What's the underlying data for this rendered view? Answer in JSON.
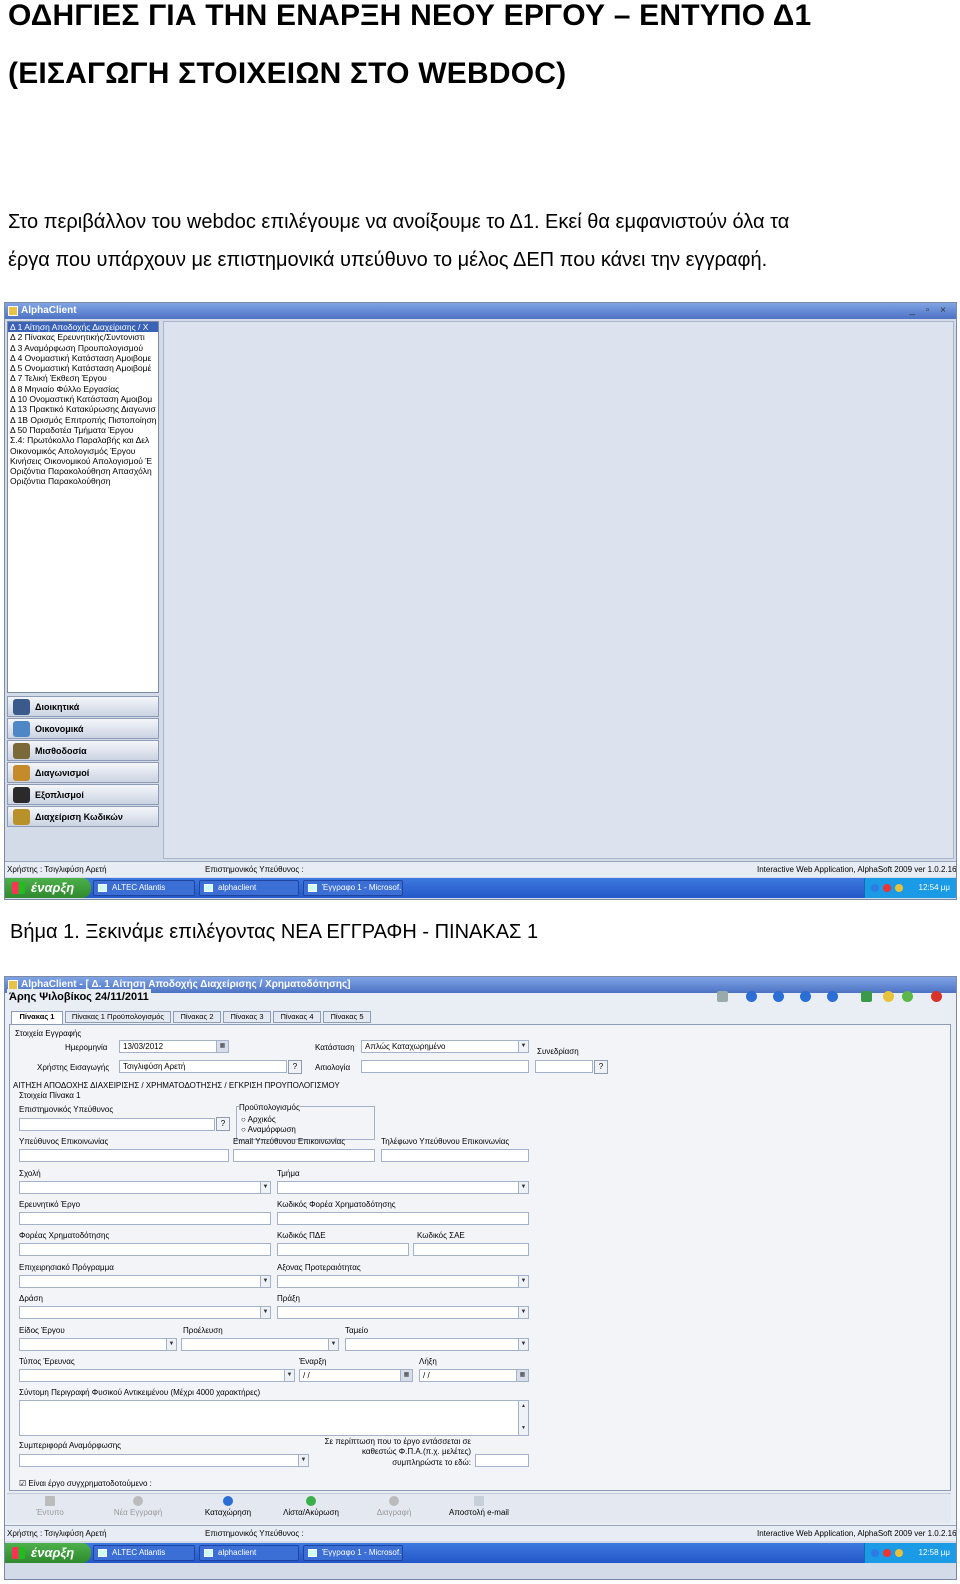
{
  "document": {
    "heading_line1": "ΟΔΗΓΙΕΣ ΓΙΑ ΤΗΝ ΕΝΑΡΞΗ ΝΕΟΥ ΕΡΓΟΥ – ΕΝΤΥΠΟ Δ1",
    "heading_line2": "(ΕΙΣΑΓΩΓΗ ΣΤΟΙΧΕΙΩΝ ΣΤΟ WEBDOC)",
    "para_line1": "Στο περιβάλλον του webdoc επιλέγουμε να ανοίξουμε το Δ1. Εκεί θα εμφανιστούν όλα τα",
    "para_line2": "έργα που υπάρχουν με επιστημονικά υπεύθυνο το μέλος ΔΕΠ που κάνει την εγγραφή.",
    "step1": "Βήμα 1. Ξεκινάμε επιλέγοντας ΝΕΑ ΕΓΓΡΑΦΗ - ΠΙΝΑΚΑΣ 1"
  },
  "screenshot1": {
    "window_title": "AlphaClient",
    "window_controls": "_ ▫ ×",
    "sidebar_items": [
      "Δ 1 Αίτηση Αποδοχής Διαχείρισης / Χ",
      "Δ 2 Πίνακας Ερευνητικής/Συντονιστι",
      "Δ 3 Αναμόρφωση Προυπολογισμού",
      "Δ 4 Ονομαστική Κατάσταση Αμοιβομε",
      "Δ 5 Ονομαστική Κατάσταση Αμοιβομέ",
      "Δ 7 Τελική Έκθεση Έργου",
      "Δ 8 Μηνιαίο Φύλλο Εργασίας",
      "Δ 10 Ονομαστική Κατάσταση Αμοιβομ",
      "Δ 13 Πρακτικό Κατακύρωσης Διαγωνισ",
      "Δ 1Β Ορισμός Επιτροπής Πιστοποίηση",
      "Δ 50 Παραδοτέα Τμήματα Έργου",
      "Σ.4: Πρωτόκολλο Παραλαβής και Δελ",
      "Οικονομικός Απολογισμός Έργου",
      "Κινήσεις Οικονομικού Απολογισμού Έ",
      "Οριζόντια Παρακολούθηση Απασχόλη",
      "Οριζόντια Παρακολούθηση"
    ],
    "nav_buttons": [
      {
        "label": "Διοικητικά",
        "color": "#3a5a8c"
      },
      {
        "label": "Οικονομικά",
        "color": "#4f86c6"
      },
      {
        "label": "Μισθοδοσία",
        "color": "#7a6a3a"
      },
      {
        "label": "Διαγωνισμοί",
        "color": "#c58a2a"
      },
      {
        "label": "Εξοπλισμοί",
        "color": "#2a2a2a"
      },
      {
        "label": "Διαχείριση Κωδικών",
        "color": "#b8912a"
      }
    ],
    "status_user": "Χρήστης : Τσιγλιφύση Αρετή",
    "status_responsible": "Επιστημονικός Υπεύθυνος :",
    "status_app": "Interactive Web Application, AlphaSoft 2009 ver 1.0.2.16"
  },
  "taskbar1": {
    "start": "έναρξη",
    "tasks": [
      "ALTEC Atlantis",
      "alphaclient",
      "Έγγραφο 1 - Microsof..."
    ],
    "clock": "12:54 μμ"
  },
  "screenshot2": {
    "window_title": "AlphaClient - [ Δ. 1 Αίτηση Αποδοχής Διαχείρισης / Χρηματοδότησης]",
    "record_title": "Άρης Ψιλοβίκος 24/11/2011",
    "tabs": [
      "Πίνακας 1",
      "Πίνακας 1 Προϋπολογισμός",
      "Πίνακας 2",
      "Πίνακας 3",
      "Πίνακας 4",
      "Πίνακας 5"
    ],
    "sec_record": "Στοιχεία Εγγραφής",
    "lbl_date": "Ημερομηνία",
    "val_date": "13/03/2012",
    "lbl_status": "Κατάσταση",
    "val_status": "Απλώς Καταχωρημένο",
    "lbl_session": "Συνεδρίαση",
    "lbl_user": "Χρήστης Εισαγωγής",
    "val_user": "Τσιγλιφύση Αρετή",
    "lbl_reason": "Αιτιολογία",
    "sec_main": "ΑΙΤΗΣΗ ΑΠΟΔΟΧΗΣ ΔΙΑΧΕΙΡΙΣΗΣ / ΧΡΗΜΑΤΟΔΟΤΗΣΗΣ / ΕΓΚΡΙΣΗ ΠΡΟΥΠΟΛΟΓΙΣΜΟΥ",
    "sec_table1": "Στοιχεία Πίνακα 1",
    "lbl_sci": "Επιστημονικός Υπεύθυνος",
    "lbl_budget": "Προϋπολογισμός",
    "opt_initial": "Αρχικός",
    "opt_reform": "Αναμόρφωση",
    "lbl_contact": "Υπεύθυνος Επικοινωνίας",
    "lbl_email": "Email Υπεύθυνου Επικοινωνίας",
    "lbl_phone": "Τηλέφωνο Υπεύθυνου Επικοινωνίας",
    "lbl_school": "Σχολή",
    "lbl_dept": "Τμήμα",
    "lbl_project": "Ερευνητικό Έργο",
    "lbl_funder_code": "Κωδικός Φορέα Χρηματοδότησης",
    "lbl_funder": "Φορέας Χρηματοδότησης",
    "lbl_pde": "Κωδικός ΠΔΕ",
    "lbl_sae": "Κωδικός ΣΑΕ",
    "lbl_program": "Επιχειρησιακό Πρόγραμμα",
    "lbl_axis": "Αξονας Προτεραιότητας",
    "lbl_measure": "Δράση",
    "lbl_action": "Πράξη",
    "lbl_type": "Είδος Έργου",
    "lbl_origin": "Προέλευση",
    "lbl_fund": "Ταμείο",
    "lbl_research": "Τύπος Έρευνας",
    "lbl_start": "Έναρξη",
    "lbl_end": "Λήξη",
    "val_start": "/ /",
    "val_end": "/ /",
    "lbl_desc": "Σύντομη Περιγραφή Φυσικού Αντικειμένου (Μέχρι 4000 χαρακτήρες)",
    "lbl_reform_behavior": "Συμπεριφορά Αναμόρφωσης",
    "note_fpa1": "Σε περίπτωση που το έργο εντάσσεται σε",
    "note_fpa2": "καθεστώς Φ.Π.Α.(π.χ. μελέτες)",
    "note_fpa3": "συμπληρώστε το εδώ:",
    "chk_cofunded": "Είναι έργο συγχρηματοδοτούμενο :",
    "bottom_buttons": [
      "Έντυπο",
      "Νέα Εγγραφή",
      "Καταχώρηση",
      "Λίστα/Ακύρωση",
      "Διαγραφή",
      "Αποστολή e-mail"
    ],
    "status_user": "Χρήστης : Τσιγλιφύση Αρετή",
    "status_responsible": "Επιστημονικός Υπεύθυνος :",
    "status_app": "Interactive Web Application, AlphaSoft 2009 ver 1.0.2.16"
  },
  "taskbar2": {
    "start": "έναρξη",
    "tasks": [
      "ALTEC Atlantis",
      "alphaclient",
      "Έγγραφο 1 - Microsof..."
    ],
    "clock": "12:58 μμ"
  }
}
